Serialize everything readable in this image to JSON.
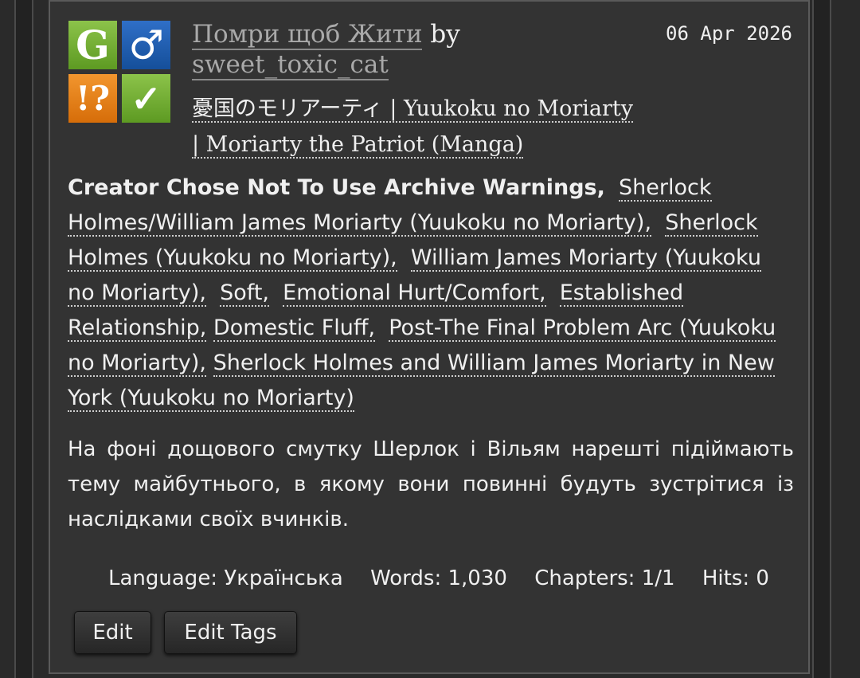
{
  "work": {
    "title": "Помри щоб Жити",
    "by": "by",
    "author": "sweet_toxic_cat",
    "date": "06 Apr 2026",
    "fandom_line1": "憂国のモリアーティ | Yuukoku no Moriarty",
    "fandom_line2": "| Moriarty the Patriot (Manga)",
    "icons": {
      "rating": "G",
      "category": "♂",
      "warnings": "!?",
      "complete": "✓"
    },
    "warning": "Creator Chose Not To Use Archive Warnings,",
    "tags": [
      "Sherlock Holmes/William James Moriarty (Yuukoku no Moriarty),",
      "Sherlock Holmes (Yuukoku no Moriarty),",
      "William James Moriarty (Yuukoku no Moriarty),",
      "Soft,",
      "Emotional Hurt/Comfort,",
      "Established Relationship,",
      "Domestic Fluff,",
      "Post-The Final Problem Arc (Yuukoku no Moriarty),",
      "Sherlock Holmes and William James Moriarty in New York (Yuukoku no Moriarty)"
    ],
    "summary": "На фоні дощового смутку Шерлок і Вільям нарешті підіймають тему майбутнього, в якому вони повинні будуть зустрітися із наслідками своїх вчинків.",
    "stats": {
      "language_label": "Language:",
      "language": "Українська",
      "words_label": "Words:",
      "words": "1,030",
      "chapters_label": "Chapters:",
      "chapters": "1/1",
      "hits_label": "Hits:",
      "hits": "0"
    },
    "buttons": {
      "edit": "Edit",
      "edit_tags": "Edit Tags"
    }
  },
  "colors": {
    "background": "#2a2a2a",
    "card": "#333333",
    "rating_green": "#7ab33a",
    "category_blue": "#2563b5",
    "warning_orange": "#ea8420"
  }
}
